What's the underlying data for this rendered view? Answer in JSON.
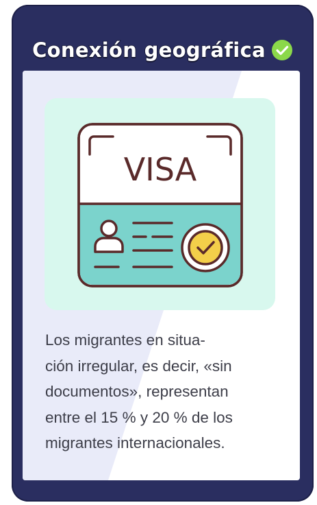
{
  "card": {
    "title": "Conexión geográfica",
    "title_icon": "check-circle-icon",
    "accent_color": "#8bd84a",
    "frame_color": "#2a2e60"
  },
  "illustration": {
    "icon": "visa-document-icon",
    "stamp_text": "VISA",
    "background_color": "#d8f8ee"
  },
  "body": {
    "text": "Los migrantes en situa-\nción irregular, es decir, «sin\ndocumentos», representan\nentre el 15 % y 20 % de los\nmigrantes internacionales."
  }
}
